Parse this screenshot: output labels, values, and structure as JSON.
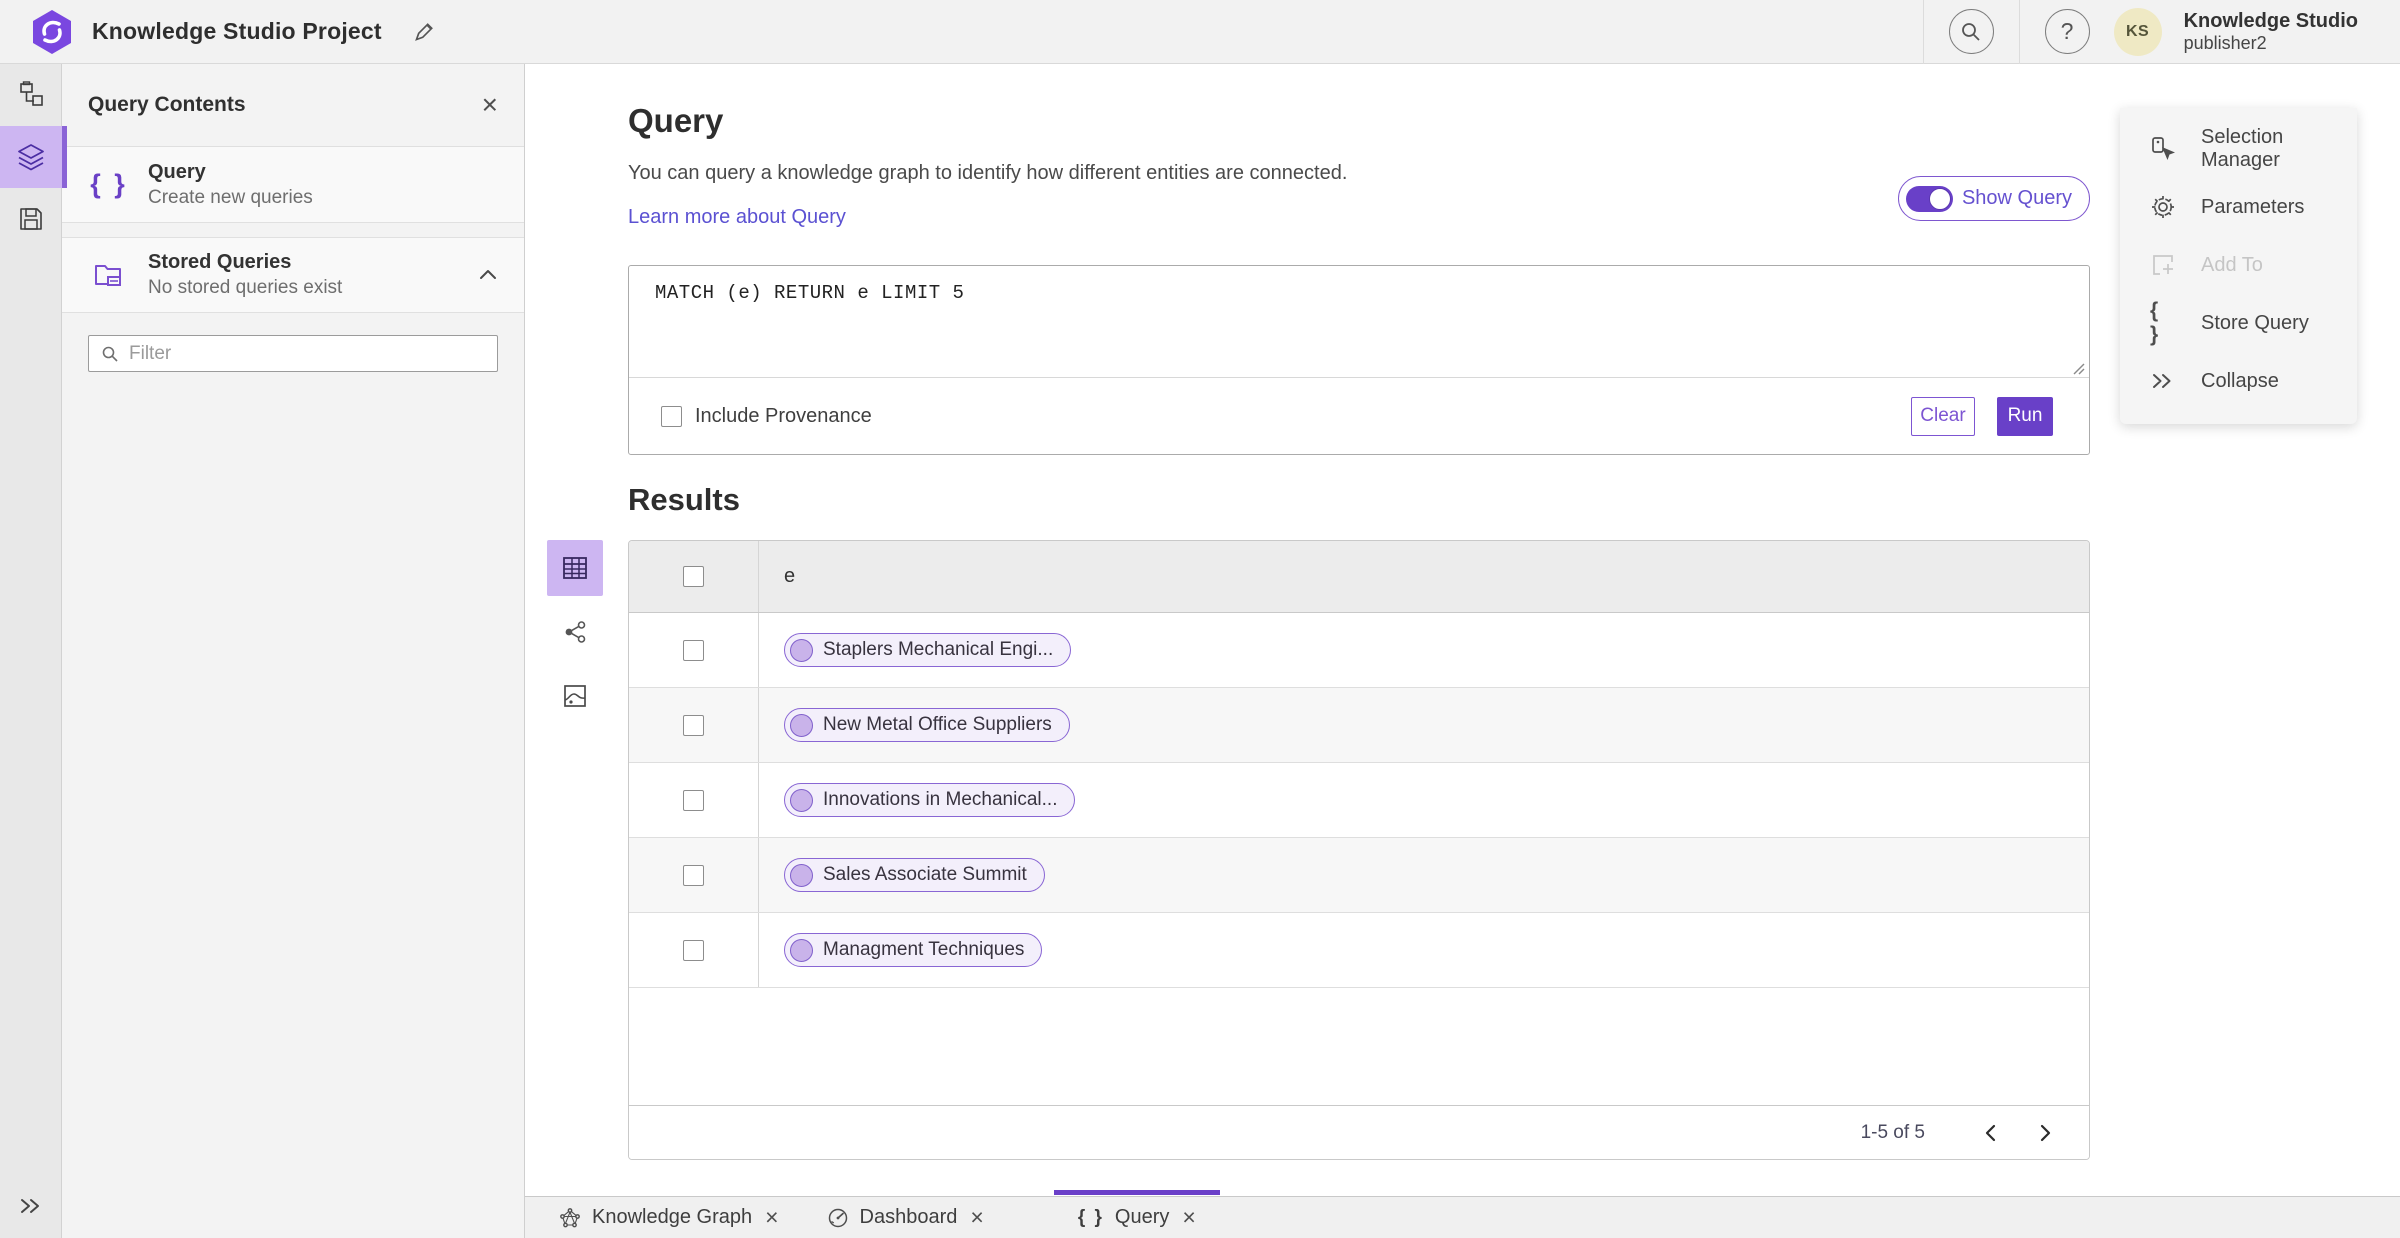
{
  "header": {
    "app_title": "Knowledge Studio Project",
    "search_icon": "search-icon",
    "help_icon": "question-icon",
    "avatar_initials": "KS",
    "user_name": "Knowledge Studio",
    "user_role": "publisher2"
  },
  "sidebar": {
    "items": [
      {
        "icon": "data-model-icon",
        "selected": false
      },
      {
        "icon": "layers-icon",
        "selected": true
      },
      {
        "icon": "save-icon",
        "selected": false
      }
    ],
    "expand_icon": "double-chevron-right-icon"
  },
  "contents_panel": {
    "title": "Query Contents",
    "items": [
      {
        "label": "Query",
        "description": "Create new queries",
        "icon": "braces-icon"
      },
      {
        "label": "Stored Queries",
        "description": "No stored queries exist",
        "icon": "stored-folder-icon"
      }
    ],
    "braces_glyph": "{ }",
    "filter_placeholder": "Filter",
    "close_glyph": "×"
  },
  "query_section": {
    "title": "Query",
    "description": "You can query a knowledge graph to identify how different entities are connected.",
    "learn_more": "Learn more about Query",
    "show_query_label": "Show Query",
    "query_text": "MATCH (e) RETURN e LIMIT 5",
    "include_provenance_label": "Include Provenance",
    "clear_label": "Clear",
    "run_label": "Run"
  },
  "results": {
    "title": "Results",
    "column_header": "e",
    "rows": [
      "Staplers Mechanical Engi...",
      "New Metal Office Suppliers",
      "Innovations in Mechanical...",
      "Sales Associate Summit",
      "Managment Techniques"
    ],
    "pagination": {
      "label": "1-5 of 5"
    }
  },
  "actions_panel": {
    "items": [
      {
        "label": "Selection Manager",
        "disabled": false
      },
      {
        "label": "Parameters",
        "disabled": false
      },
      {
        "label": "Add To",
        "disabled": true
      },
      {
        "label": "Store Query",
        "disabled": false
      },
      {
        "label": "Collapse",
        "disabled": false
      }
    ],
    "braces_glyph": "{ }",
    "gear_glyph": "⚙"
  },
  "tabs": [
    {
      "label": "Knowledge Graph",
      "active": false
    },
    {
      "label": "Dashboard",
      "active": false
    },
    {
      "label": "Query",
      "active": true
    }
  ],
  "tab_close_glyph": "×",
  "colors": {
    "brand_purple": "#6a40c8",
    "brand_light": "#cdb6f2",
    "link": "#5b51d2",
    "avatar_bg": "#efe9c4"
  }
}
